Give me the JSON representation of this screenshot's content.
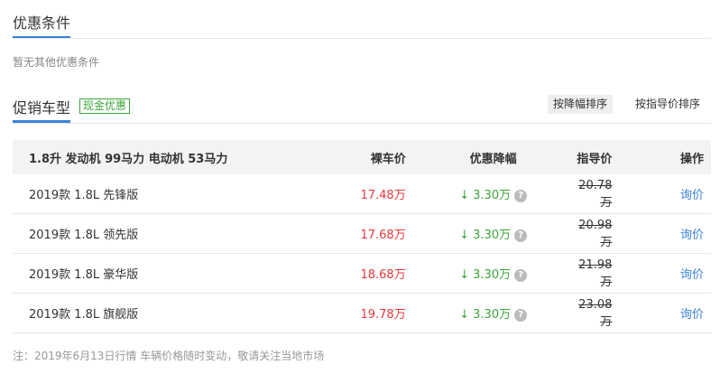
{
  "discount_conditions": {
    "title": "优惠条件",
    "empty_note": "暂无其他优惠条件"
  },
  "promo_models": {
    "title": "促销车型",
    "badge": "现金优惠",
    "sort_by_discount": "按降幅排序",
    "sort_by_guide_price": "按指导价排序"
  },
  "table": {
    "headers": {
      "name": "1.8升 发动机 99马力 电动机 53马力",
      "bare_price": "裸车价",
      "discount": "优惠降幅",
      "guide_price": "指导价",
      "action": "操作"
    },
    "rows": [
      {
        "name": "2019款 1.8L 先锋版",
        "bare_price": "17.48万",
        "discount": "3.30万",
        "guide_price": "20.78万",
        "action": "询价"
      },
      {
        "name": "2019款 1.8L 领先版",
        "bare_price": "17.68万",
        "discount": "3.30万",
        "guide_price": "20.98万",
        "action": "询价"
      },
      {
        "name": "2019款 1.8L 豪华版",
        "bare_price": "18.68万",
        "discount": "3.30万",
        "guide_price": "21.98万",
        "action": "询价"
      },
      {
        "name": "2019款 1.8L 旗舰版",
        "bare_price": "19.78万",
        "discount": "3.30万",
        "guide_price": "23.08万",
        "action": "询价"
      }
    ]
  },
  "icons": {
    "down_arrow": "↓",
    "question": "?"
  },
  "footnote": "注：2019年6月13日行情 车辆价格随时变动，敬请关注当地市场",
  "colors": {
    "accent": "#3b82d8",
    "price": "#e8383d",
    "discount": "#3aa63a"
  }
}
